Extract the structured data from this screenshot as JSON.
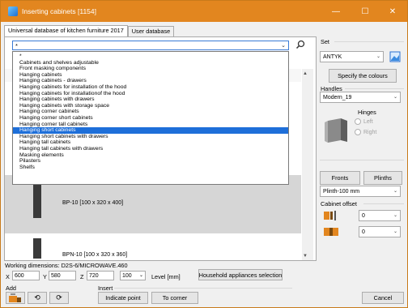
{
  "window": {
    "title": "Inserting cabinets [1154]",
    "minimize": "—",
    "maximize": "☐",
    "close": "✕"
  },
  "tabs": [
    {
      "label": "Universal database of kitchen furniture 2017"
    },
    {
      "label": "User database"
    }
  ],
  "category_combo": {
    "value": "*"
  },
  "dropdown_items": [
    "*",
    "Cabinets and shelves adjustable",
    "Front masking components",
    "Hanging cabinets",
    "Hanging cabinets - drawers",
    "Hanging cabinets for installation of the hood",
    "Hanging cabinets for installationof the hood",
    "Hanging cabinets with drawers",
    "Hanging cabinets with storage space",
    "Hanging corner cabinets",
    "Hanging corner short cabinets",
    "Hanging corner tall cabinets",
    "Hanging short cabinets",
    "Hanging short cabinets with drawers",
    "Hanging tall cabinets",
    "Hanging tall cabinets with drawers",
    "Masking elements",
    "Pilasters",
    "Shelfs"
  ],
  "selected_item": "Hanging short cabinets",
  "rows": [
    {
      "label": "BP-10  [100 x 320 x 400]"
    },
    {
      "label": "BPN-10  [100 x 320 x 360]"
    }
  ],
  "right": {
    "set_label": "Set",
    "set_value": "ANTYK",
    "specify_colours": "Specify the colours",
    "handles_label": "Handles",
    "handles_value": "Modern_19",
    "hinges_label": "Hinges",
    "hinge_left": "Left",
    "hinge_right": "Right",
    "fronts": "Fronts",
    "plinths": "Plinths",
    "plinth_value": "Plinth-100 mm",
    "offset_label": "Cabinet offset",
    "offset1": "0",
    "offset2": "0"
  },
  "bottom": {
    "working_dimensions": "Working dimensions: D2S-6/MICROWAVE.460",
    "x_label": "X",
    "x_value": "600",
    "y_label": "Y",
    "y_value": "580",
    "z_label": "Z",
    "z_value": "720",
    "level_value": "100",
    "level_label": "Level [mm]",
    "household_btn": "Household appliances selection",
    "add_label": "Add",
    "insert_label": "Insert",
    "indicate_point": "Indicate point",
    "to_corner": "To corner",
    "cancel": "Cancel"
  },
  "colors": {
    "titlebar": "#e2861f",
    "selection": "#1e6fd9"
  },
  "icons": {
    "search": "magnifier-icon",
    "add_cabinet": "cabinet-add-icon",
    "rotate_left": "rotate-left-icon",
    "rotate_right": "rotate-right-icon",
    "hinge_preview": "cabinet-3d-icon",
    "offset1": "offset-left-icon",
    "offset2": "offset-right-icon"
  }
}
